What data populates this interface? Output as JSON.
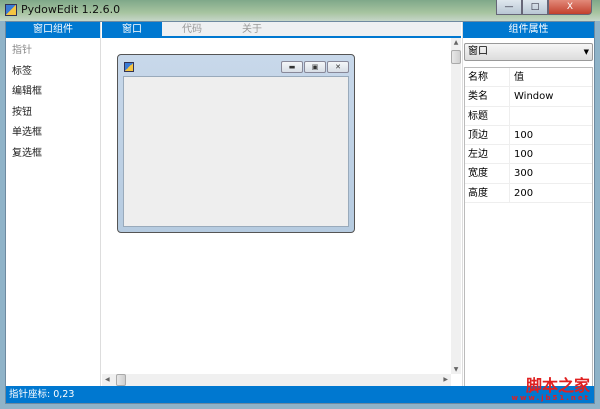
{
  "app": {
    "title": "PydowEdit 1.2.6.0"
  },
  "window_controls": {
    "minimize": "—",
    "maximize": "□",
    "close": "X"
  },
  "left_panel": {
    "header": "窗口组件",
    "items": [
      {
        "label": "指针"
      },
      {
        "label": "标签"
      },
      {
        "label": "编辑框"
      },
      {
        "label": "按钮"
      },
      {
        "label": "单选框"
      },
      {
        "label": "复选框"
      }
    ]
  },
  "tabs": [
    {
      "label": "窗口"
    },
    {
      "label": "代码"
    },
    {
      "label": "关于"
    }
  ],
  "right_panel": {
    "header": "组件属性",
    "selector": "窗口",
    "columns": {
      "name": "名称",
      "value": "值"
    },
    "properties": [
      {
        "name": "类名",
        "value": "Window"
      },
      {
        "name": "标题",
        "value": ""
      },
      {
        "name": "顶边",
        "value": "100"
      },
      {
        "name": "左边",
        "value": "100"
      },
      {
        "name": "宽度",
        "value": "300"
      },
      {
        "name": "高度",
        "value": "200"
      }
    ]
  },
  "status": {
    "text": "指针座标: 0,23"
  },
  "watermark": {
    "text": "脚本之家",
    "url": "www.jb51.net"
  }
}
